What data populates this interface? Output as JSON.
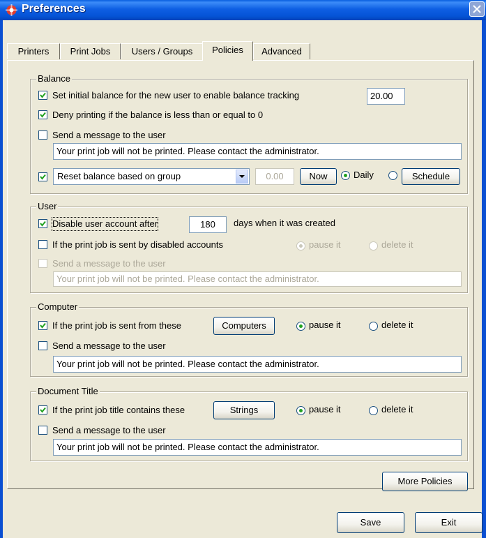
{
  "window": {
    "title": "Preferences"
  },
  "tabs": [
    {
      "label": "Printers"
    },
    {
      "label": "Print Jobs"
    },
    {
      "label": "Users / Groups"
    },
    {
      "label": "Policies"
    },
    {
      "label": "Advanced"
    }
  ],
  "balance": {
    "legend": "Balance",
    "initial_label": "Set initial balance for the new user to enable balance tracking",
    "initial_checked": true,
    "initial_value": "20.00",
    "deny_label": "Deny printing if the balance is less than or equal to 0",
    "deny_checked": true,
    "send_label": "Send a message to the user",
    "send_checked": false,
    "message": "Your print job will not be printed.  Please contact the administrator.",
    "reset_checked": true,
    "reset_option": "Reset balance based on group",
    "reset_amount": "0.00",
    "now_label": "Now",
    "daily_label": "Daily",
    "schedule_label": "Schedule"
  },
  "user": {
    "legend": "User",
    "disable_label": "Disable user account after",
    "disable_checked": true,
    "days_value": "180",
    "days_suffix": "days when it was created",
    "sent_label": "If the print job is sent by disabled accounts",
    "sent_checked": false,
    "pause_label": "pause it",
    "delete_label": "delete it",
    "send_label": "Send a message to the user",
    "message": "Your print job will not be printed.  Please contact the administrator."
  },
  "computer": {
    "legend": "Computer",
    "from_label": "If the print job is sent from  these",
    "from_checked": true,
    "computers_button": "Computers",
    "pause_label": "pause it",
    "delete_label": "delete it",
    "send_label": "Send a message to the user",
    "message": "Your print job will not be printed.  Please contact the administrator."
  },
  "doc_title": {
    "legend": "Document Title",
    "contains_label": "If the print job title contains these",
    "contains_checked": true,
    "strings_button": "Strings",
    "pause_label": "pause it",
    "delete_label": "delete it",
    "send_label": "Send a message to the user",
    "message": "Your print job will not be printed.  Please contact the administrator."
  },
  "buttons": {
    "more_policies": "More Policies",
    "save": "Save",
    "exit": "Exit"
  }
}
